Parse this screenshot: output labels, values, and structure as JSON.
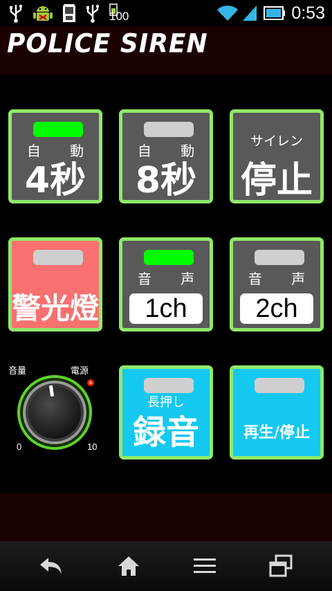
{
  "status_bar": {
    "time": "0:53",
    "battery_level": "100",
    "icons": [
      "usb-icon",
      "android-debug-icon",
      "sd-card-icon",
      "usb-icon",
      "battery-charging-icon",
      "wifi-icon",
      "signal-icon",
      "battery-icon"
    ]
  },
  "app": {
    "title": "POLICE SIREN"
  },
  "buttons": {
    "auto4": {
      "top": "自 動",
      "main": "4秒",
      "led_on": true
    },
    "auto8": {
      "top": "自 動",
      "main": "8秒",
      "led_on": false
    },
    "siren_stop": {
      "top": "サイレン",
      "main": "停止"
    },
    "warning_light": {
      "main": "警光燈",
      "led_on": false
    },
    "voice1": {
      "top": "音 声",
      "main": "1ch",
      "led_on": true
    },
    "voice2": {
      "top": "音 声",
      "main": "2ch",
      "led_on": false
    },
    "record": {
      "top": "長押し",
      "main": "録音",
      "led_on": false
    },
    "play_stop": {
      "main": "再生/停止",
      "led_on": false
    }
  },
  "volume": {
    "label_volume": "音量",
    "label_power": "電源",
    "min": "0",
    "max": "10",
    "power_indicator_color": "#ff2200"
  },
  "colors": {
    "border": "#8fe96b",
    "button_gray": "#595959",
    "button_red": "#f87070",
    "button_cyan": "#15c8f0",
    "led_on": "#00ff00",
    "led_off": "#cfcfcf"
  },
  "nav": [
    "back-icon",
    "home-icon",
    "menu-icon",
    "recent-apps-icon"
  ]
}
